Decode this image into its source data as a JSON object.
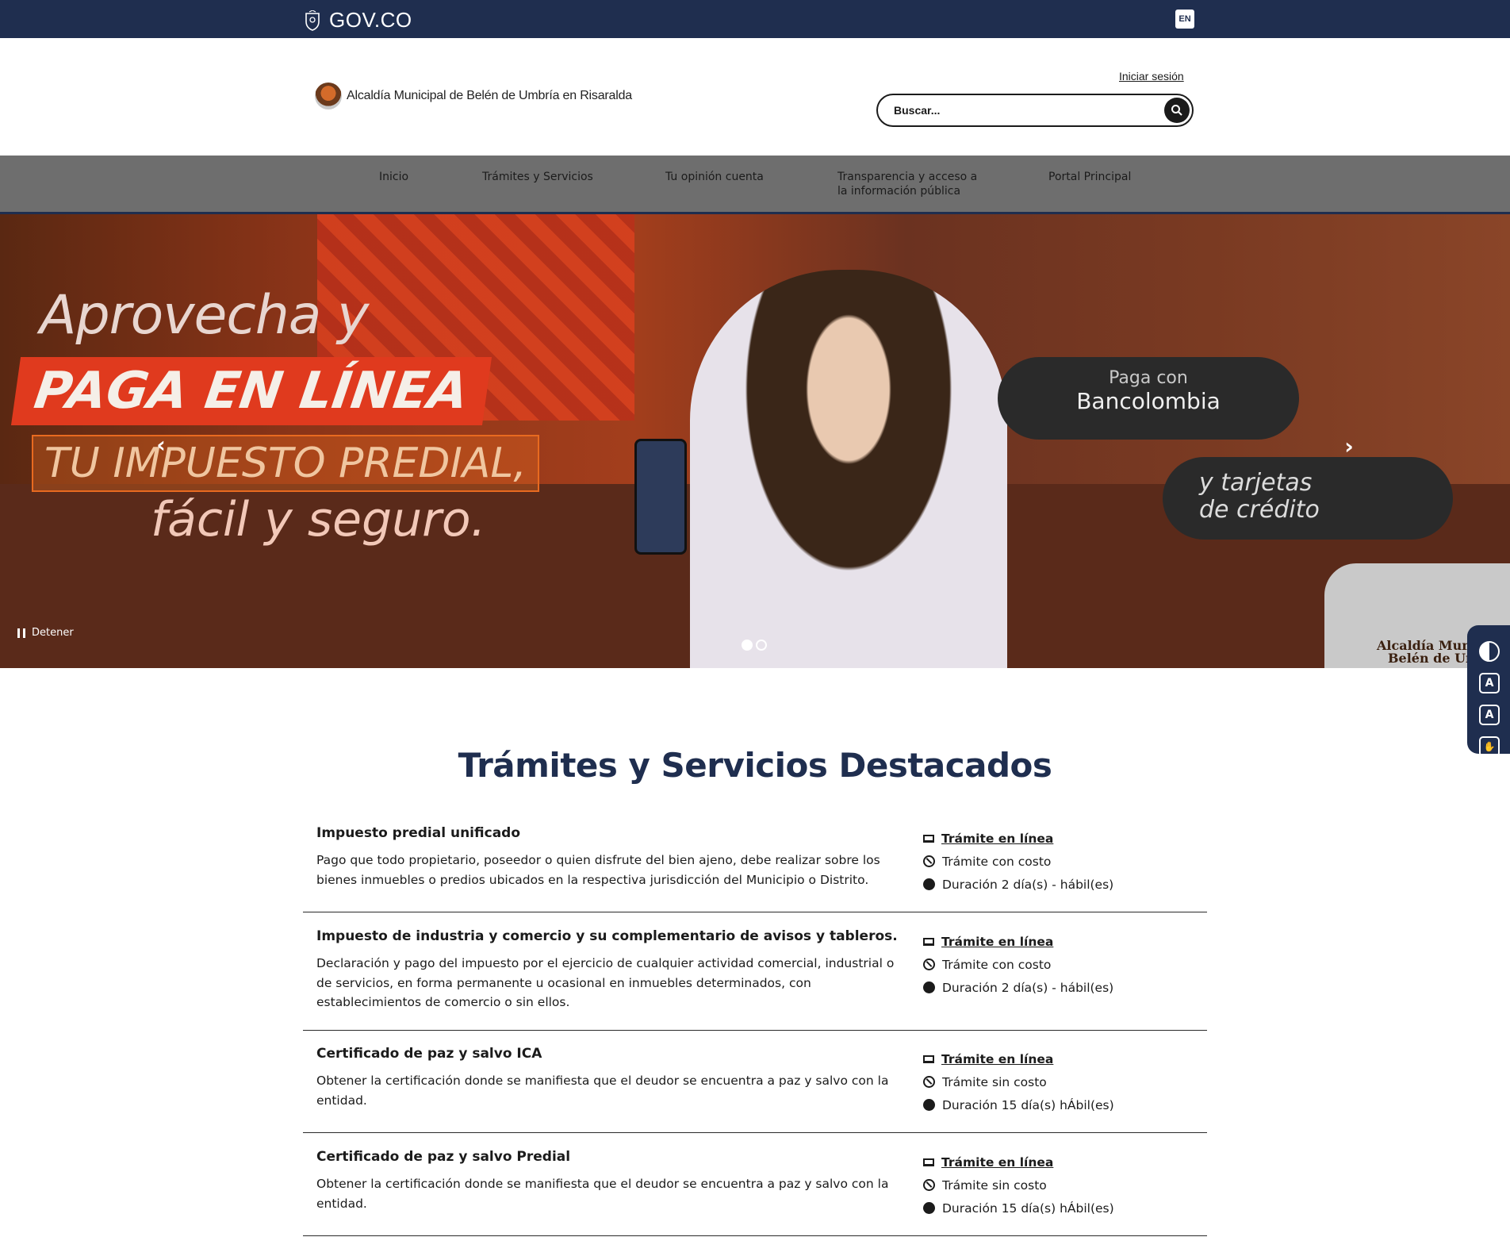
{
  "gov_bar": {
    "logo_text": "GOV.CO",
    "lang_button": "EN",
    "bg_color": "#1f2e4f"
  },
  "header": {
    "entity_name": "Alcaldía Municipal de Belén de Umbría en Risaralda",
    "login_link": "Iniciar sesión",
    "search_placeholder": "Buscar..."
  },
  "nav": {
    "items": [
      {
        "label": "Inicio"
      },
      {
        "label": "Trámites y Servicios"
      },
      {
        "label": "Tu opinión cuenta"
      },
      {
        "label": "Transparencia y acceso a la información pública"
      },
      {
        "label": "Portal Principal"
      }
    ]
  },
  "hero": {
    "line1": "Aprovecha y",
    "line2": "PAGA EN LÍNEA",
    "line3": "TU IMPUESTO PREDIAL,",
    "line4": "fácil y seguro.",
    "pay_with": "Paga con",
    "bank": "Bancolombia",
    "cards_line1": "y tarjetas",
    "cards_line2": "de crédito",
    "badge_line1": "Alcaldía Mun",
    "badge_line2": "Belén de Um",
    "pause_label": "Detener",
    "slide_count": 2,
    "active_slide": 1
  },
  "accessibility": {
    "tools": [
      "contrast-icon",
      "decrease-text-icon",
      "increase-text-icon",
      "sign-language-icon"
    ]
  },
  "section": {
    "title": "Trámites y Servicios Destacados",
    "services": [
      {
        "name": "Impuesto predial unificado",
        "description": "Pago que todo propietario, poseedor o quien disfrute del bien ajeno, debe realizar sobre los bienes inmuebles o predios ubicados en la respectiva jurisdicción del Municipio o Distrito.",
        "online": "Trámite en línea",
        "cost": "Trámite con costo",
        "duration": "Duración 2 día(s) - hábil(es)"
      },
      {
        "name": "Impuesto de industria y comercio y su complementario de avisos y tableros.",
        "description": "Declaración y pago del impuesto por el ejercicio de cualquier actividad comercial, industrial o de servicios, en forma permanente u ocasional en inmuebles determinados, con establecimientos de comercio o sin ellos.",
        "online": "Trámite en línea",
        "cost": "Trámite con costo",
        "duration": "Duración 2 día(s) - hábil(es)"
      },
      {
        "name": "Certificado de paz y salvo ICA",
        "description": "Obtener la certificación donde se manifiesta que el deudor se encuentra a paz y salvo con la entidad.",
        "online": "Trámite en línea",
        "cost": "Trámite sin costo",
        "duration": "Duración 15 día(s) hÁbil(es)"
      },
      {
        "name": "Certificado de paz y salvo Predial",
        "description": "Obtener la certificación donde se manifiesta que el deudor se encuentra a paz y salvo con la entidad.",
        "online": "Trámite en línea",
        "cost": "Trámite sin costo",
        "duration": "Duración 15 día(s) hÁbil(es)"
      }
    ]
  }
}
